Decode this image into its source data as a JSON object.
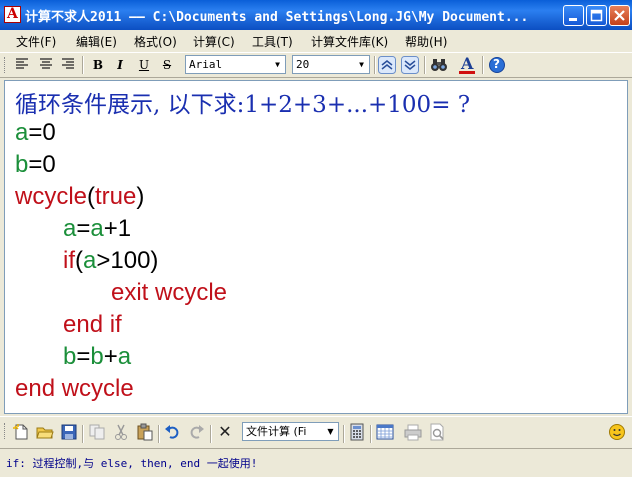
{
  "window": {
    "title": "计算不求人2011 —— C:\\Documents and Settings\\Long.JG\\My Document...",
    "app_icon_letter": "A"
  },
  "menu": [
    {
      "label": "文件(F)"
    },
    {
      "label": "编辑(E)"
    },
    {
      "label": "格式(O)"
    },
    {
      "label": "计算(C)"
    },
    {
      "label": "工具(T)"
    },
    {
      "label": "计算文件库(K)"
    },
    {
      "label": "帮助(H)"
    }
  ],
  "format_toolbar": {
    "bold": "B",
    "italic": "I",
    "underline": "U",
    "strike": "S",
    "font_name": "Arial",
    "font_size": "20",
    "color_letter": "A",
    "help_symbol": "?"
  },
  "editor": {
    "heading": "循环条件展示, 以下求:1+2+3+...+100= ?",
    "lines": {
      "l1": {
        "a": "a",
        "b": "=0"
      },
      "l2": {
        "a": "b",
        "b": "=0"
      },
      "l3": {
        "a": "wcycle",
        "b": "(",
        "c": "true",
        "d": ")"
      },
      "l4": {
        "a": "a",
        "b": "=",
        "c": "a",
        "d": "+1"
      },
      "l5": {
        "a": "if",
        "b": "(",
        "c": "a",
        "d": ">100)"
      },
      "l6": {
        "a": "exit wcycle"
      },
      "l7": {
        "a": "end if"
      },
      "l8": {
        "a": "b",
        "b": "=",
        "c": "b",
        "d": "+",
        "e": "a"
      },
      "l9": {
        "a": "end wcycle"
      }
    }
  },
  "bottom_toolbar": {
    "mode_combo": "文件计算 (Fi",
    "delete_symbol": "✕"
  },
  "status": {
    "text": "if: 过程控制,与 else, then, end 一起使用!"
  },
  "colors": {
    "title_bar": "#1a64d6",
    "heading": "#1a2fb0",
    "variable": "#1b8f3a",
    "keyword": "#c0101a",
    "status_text": "#00008b"
  }
}
